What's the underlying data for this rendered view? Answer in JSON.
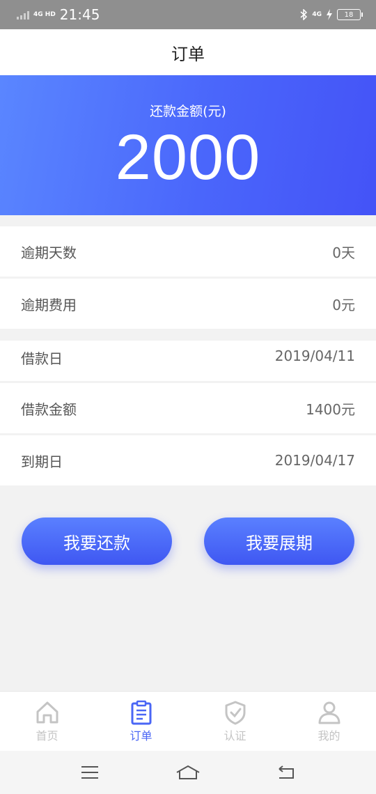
{
  "status_bar": {
    "network": "4G HD",
    "time": "21:45",
    "network_right": "4G",
    "battery": "18"
  },
  "header": {
    "title": "订单"
  },
  "summary": {
    "label": "还款金额(元)",
    "amount": "2000"
  },
  "group1": [
    {
      "label": "逾期天数",
      "value": "0天"
    },
    {
      "label": "逾期费用",
      "value": "0元"
    }
  ],
  "group2": [
    {
      "label": "借款日",
      "value": "2019/04/11"
    },
    {
      "label": "借款金额",
      "value": "1400元"
    },
    {
      "label": "到期日",
      "value": "2019/04/17"
    }
  ],
  "actions": {
    "repay": "我要还款",
    "extend": "我要展期"
  },
  "tabs": [
    {
      "label": "首页",
      "icon": "home-icon"
    },
    {
      "label": "订单",
      "icon": "order-icon",
      "active": true
    },
    {
      "label": "认证",
      "icon": "shield-check-icon"
    },
    {
      "label": "我的",
      "icon": "user-icon"
    }
  ],
  "colors": {
    "accent": "#4a66f5",
    "inactive": "#c4c4c4"
  }
}
